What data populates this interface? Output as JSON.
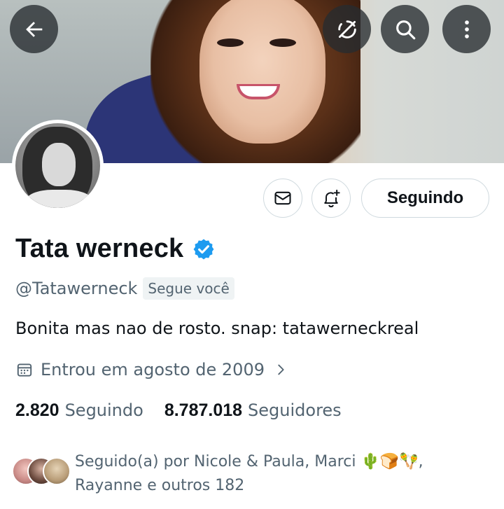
{
  "header": {
    "back_icon": "arrow-left-icon",
    "sync_icon": "no-sync-icon",
    "search_icon": "search-icon",
    "more_icon": "more-vertical-icon"
  },
  "profile": {
    "name": "Tata werneck",
    "handle": "@Tatawerneck",
    "follows_you_badge": "Segue você",
    "bio": "Bonita mas nao de rosto. snap: tatawerneckreal",
    "joined": "Entrou em agosto de 2009",
    "verified_color": "#1d9bf0"
  },
  "actions": {
    "message_icon": "envelope-icon",
    "notify_icon": "bell-plus-icon",
    "following_label": "Seguindo"
  },
  "stats": {
    "following_count": "2.820",
    "following_label": "Seguindo",
    "followers_count": "8.787.018",
    "followers_label": "Seguidores"
  },
  "followed_by": {
    "line1": "Seguido(a) por Nicole & Paula, Marci 🌵🍞🪇,",
    "line2": "Rayanne e outros 182"
  },
  "colors": {
    "text_primary": "#0f1419",
    "text_secondary": "#536471",
    "border": "#cfd9de",
    "overlay_button": "#262b2f"
  }
}
